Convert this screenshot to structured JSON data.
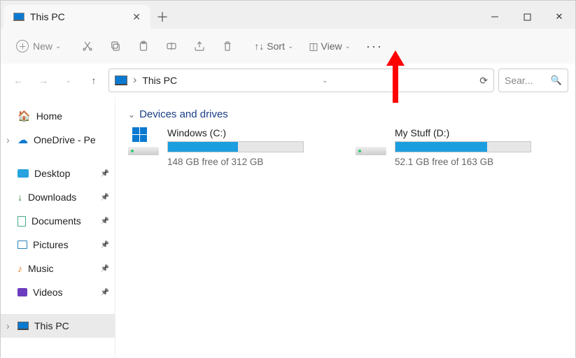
{
  "tab": {
    "title": "This PC"
  },
  "toolbar": {
    "new_label": "New",
    "sort_label": "Sort",
    "view_label": "View"
  },
  "address": {
    "crumb": "This PC"
  },
  "search": {
    "placeholder": "Sear..."
  },
  "sidebar": {
    "home": "Home",
    "onedrive": "OneDrive - Pe",
    "desktop": "Desktop",
    "downloads": "Downloads",
    "documents": "Documents",
    "pictures": "Pictures",
    "music": "Music",
    "videos": "Videos",
    "thispc": "This PC"
  },
  "group": {
    "title": "Devices and drives"
  },
  "drives": [
    {
      "name": "Windows (C:)",
      "free_text": "148 GB free of 312 GB",
      "fill_percent": 52,
      "has_logo": true
    },
    {
      "name": "My Stuff (D:)",
      "free_text": "52.1 GB free of 163 GB",
      "fill_percent": 68,
      "has_logo": false
    }
  ]
}
